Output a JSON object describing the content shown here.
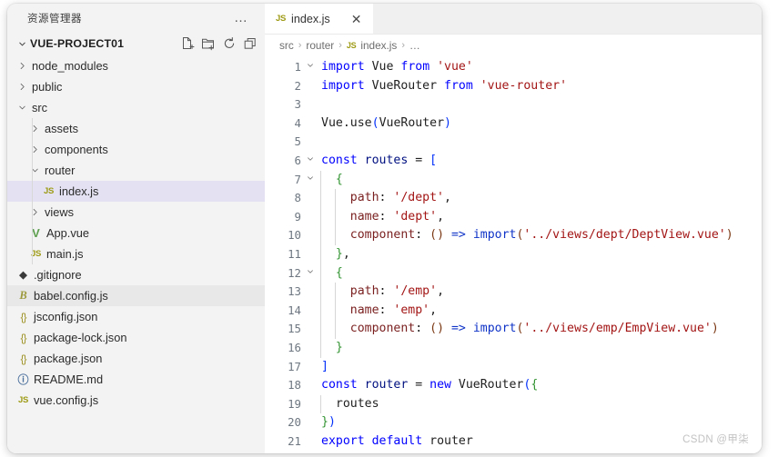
{
  "window": {
    "accent_selection": "#e4e2f2",
    "sidebar_bg": "#f3f3f3"
  },
  "sidebar": {
    "header_title": "资源管理器",
    "more_actions": "…",
    "project": {
      "name": "VUE-PROJECT01",
      "expanded": true,
      "actions": [
        {
          "name": "new-file",
          "tooltip": "New File"
        },
        {
          "name": "new-folder",
          "tooltip": "New Folder"
        },
        {
          "name": "refresh",
          "tooltip": "Refresh Explorer"
        },
        {
          "name": "collapse-all",
          "tooltip": "Collapse Folders in Explorer"
        }
      ]
    },
    "tree": [
      {
        "label": "node_modules",
        "type": "folder",
        "expanded": false,
        "depth": 1,
        "icon": "chevron-right-icon",
        "state": ""
      },
      {
        "label": "public",
        "type": "folder",
        "expanded": false,
        "depth": 1,
        "icon": "chevron-right-icon",
        "state": ""
      },
      {
        "label": "src",
        "type": "folder",
        "expanded": true,
        "depth": 1,
        "icon": "chevron-down-icon",
        "state": ""
      },
      {
        "label": "assets",
        "type": "folder",
        "expanded": false,
        "depth": 2,
        "icon": "chevron-right-icon",
        "state": ""
      },
      {
        "label": "components",
        "type": "folder",
        "expanded": false,
        "depth": 2,
        "icon": "chevron-right-icon",
        "state": ""
      },
      {
        "label": "router",
        "type": "folder",
        "expanded": true,
        "depth": 2,
        "icon": "chevron-down-icon",
        "state": ""
      },
      {
        "label": "index.js",
        "type": "file",
        "depth": 3,
        "icon": "js-file-icon",
        "state": "selected"
      },
      {
        "label": "views",
        "type": "folder",
        "expanded": false,
        "depth": 2,
        "icon": "chevron-right-icon",
        "state": ""
      },
      {
        "label": "App.vue",
        "type": "file",
        "depth": 2,
        "icon": "vue-file-icon",
        "state": ""
      },
      {
        "label": "main.js",
        "type": "file",
        "depth": 2,
        "icon": "js-file-icon",
        "state": ""
      },
      {
        "label": ".gitignore",
        "type": "file",
        "depth": 1,
        "icon": "git-file-icon",
        "state": ""
      },
      {
        "label": "babel.config.js",
        "type": "file",
        "depth": 1,
        "icon": "babel-file-icon",
        "state": "hover"
      },
      {
        "label": "jsconfig.json",
        "type": "file",
        "depth": 1,
        "icon": "json-file-icon",
        "state": ""
      },
      {
        "label": "package-lock.json",
        "type": "file",
        "depth": 1,
        "icon": "json-file-icon",
        "state": ""
      },
      {
        "label": "package.json",
        "type": "file",
        "depth": 1,
        "icon": "json-file-icon",
        "state": ""
      },
      {
        "label": "README.md",
        "type": "file",
        "depth": 1,
        "icon": "markdown-file-icon",
        "state": ""
      },
      {
        "label": "vue.config.js",
        "type": "file",
        "depth": 1,
        "icon": "js-file-icon",
        "state": ""
      }
    ]
  },
  "editor": {
    "tabs": [
      {
        "label": "index.js",
        "icon": "js-file-icon",
        "active": true,
        "close_label": "✕"
      }
    ],
    "breadcrumb": [
      {
        "label": "src",
        "icon": ""
      },
      {
        "label": "router",
        "icon": ""
      },
      {
        "label": "index.js",
        "icon": "js-file-icon"
      },
      {
        "label": "…",
        "icon": ""
      }
    ],
    "breadcrumb_separator": "›",
    "lines": [
      {
        "n": "1",
        "fold": "down",
        "guides": 0,
        "tokens": [
          {
            "t": "import",
            "c": "kw"
          },
          {
            "t": " ",
            "c": "op"
          },
          {
            "t": "Vue",
            "c": "id"
          },
          {
            "t": " ",
            "c": "op"
          },
          {
            "t": "from",
            "c": "kw"
          },
          {
            "t": " ",
            "c": "op"
          },
          {
            "t": "'vue'",
            "c": "str"
          }
        ]
      },
      {
        "n": "2",
        "fold": "",
        "guides": 0,
        "tokens": [
          {
            "t": "import",
            "c": "kw"
          },
          {
            "t": " ",
            "c": "op"
          },
          {
            "t": "VueRouter",
            "c": "id"
          },
          {
            "t": " ",
            "c": "op"
          },
          {
            "t": "from",
            "c": "kw"
          },
          {
            "t": " ",
            "c": "op"
          },
          {
            "t": "'vue-router'",
            "c": "str"
          }
        ]
      },
      {
        "n": "3",
        "fold": "",
        "guides": 0,
        "tokens": []
      },
      {
        "n": "4",
        "fold": "",
        "guides": 0,
        "tokens": [
          {
            "t": "Vue",
            "c": "id"
          },
          {
            "t": ".",
            "c": "op"
          },
          {
            "t": "use",
            "c": "fn"
          },
          {
            "t": "(",
            "c": "br0"
          },
          {
            "t": "VueRouter",
            "c": "id"
          },
          {
            "t": ")",
            "c": "br0"
          }
        ]
      },
      {
        "n": "5",
        "fold": "",
        "guides": 0,
        "tokens": []
      },
      {
        "n": "6",
        "fold": "down",
        "guides": 0,
        "tokens": [
          {
            "t": "const",
            "c": "kw"
          },
          {
            "t": " ",
            "c": "op"
          },
          {
            "t": "routes",
            "c": "pl"
          },
          {
            "t": " = ",
            "c": "op"
          },
          {
            "t": "[",
            "c": "br0"
          }
        ]
      },
      {
        "n": "7",
        "fold": "down",
        "guides": 1,
        "tokens": [
          {
            "t": "  ",
            "c": "op"
          },
          {
            "t": "{",
            "c": "br1"
          }
        ]
      },
      {
        "n": "8",
        "fold": "",
        "guides": 2,
        "tokens": [
          {
            "t": "    ",
            "c": "op"
          },
          {
            "t": "path",
            "c": "prop"
          },
          {
            "t": ": ",
            "c": "op"
          },
          {
            "t": "'/dept'",
            "c": "str"
          },
          {
            "t": ",",
            "c": "op"
          }
        ]
      },
      {
        "n": "9",
        "fold": "",
        "guides": 2,
        "tokens": [
          {
            "t": "    ",
            "c": "op"
          },
          {
            "t": "name",
            "c": "prop"
          },
          {
            "t": ": ",
            "c": "op"
          },
          {
            "t": "'dept'",
            "c": "str"
          },
          {
            "t": ",",
            "c": "op"
          }
        ]
      },
      {
        "n": "10",
        "fold": "",
        "guides": 2,
        "tokens": [
          {
            "t": "    ",
            "c": "op"
          },
          {
            "t": "component",
            "c": "prop"
          },
          {
            "t": ": ",
            "c": "op"
          },
          {
            "t": "(",
            "c": "br2"
          },
          {
            "t": ")",
            "c": "br2"
          },
          {
            "t": " ",
            "c": "op"
          },
          {
            "t": "=>",
            "c": "kw2"
          },
          {
            "t": " ",
            "c": "op"
          },
          {
            "t": "import",
            "c": "kw2"
          },
          {
            "t": "(",
            "c": "br2"
          },
          {
            "t": "'../views/dept/DeptView.vue'",
            "c": "str"
          },
          {
            "t": ")",
            "c": "br2"
          }
        ]
      },
      {
        "n": "11",
        "fold": "",
        "guides": 1,
        "tokens": [
          {
            "t": "  ",
            "c": "op"
          },
          {
            "t": "}",
            "c": "br1"
          },
          {
            "t": ",",
            "c": "op"
          }
        ]
      },
      {
        "n": "12",
        "fold": "down",
        "guides": 1,
        "tokens": [
          {
            "t": "  ",
            "c": "op"
          },
          {
            "t": "{",
            "c": "br1"
          }
        ]
      },
      {
        "n": "13",
        "fold": "",
        "guides": 2,
        "tokens": [
          {
            "t": "    ",
            "c": "op"
          },
          {
            "t": "path",
            "c": "prop"
          },
          {
            "t": ": ",
            "c": "op"
          },
          {
            "t": "'/emp'",
            "c": "str"
          },
          {
            "t": ",",
            "c": "op"
          }
        ]
      },
      {
        "n": "14",
        "fold": "",
        "guides": 2,
        "tokens": [
          {
            "t": "    ",
            "c": "op"
          },
          {
            "t": "name",
            "c": "prop"
          },
          {
            "t": ": ",
            "c": "op"
          },
          {
            "t": "'emp'",
            "c": "str"
          },
          {
            "t": ",",
            "c": "op"
          }
        ]
      },
      {
        "n": "15",
        "fold": "",
        "guides": 2,
        "tokens": [
          {
            "t": "    ",
            "c": "op"
          },
          {
            "t": "component",
            "c": "prop"
          },
          {
            "t": ": ",
            "c": "op"
          },
          {
            "t": "(",
            "c": "br2"
          },
          {
            "t": ")",
            "c": "br2"
          },
          {
            "t": " ",
            "c": "op"
          },
          {
            "t": "=>",
            "c": "kw2"
          },
          {
            "t": " ",
            "c": "op"
          },
          {
            "t": "import",
            "c": "kw2"
          },
          {
            "t": "(",
            "c": "br2"
          },
          {
            "t": "'../views/emp/EmpView.vue'",
            "c": "str"
          },
          {
            "t": ")",
            "c": "br2"
          }
        ]
      },
      {
        "n": "16",
        "fold": "",
        "guides": 1,
        "tokens": [
          {
            "t": "  ",
            "c": "op"
          },
          {
            "t": "}",
            "c": "br1"
          }
        ]
      },
      {
        "n": "17",
        "fold": "",
        "guides": 0,
        "tokens": [
          {
            "t": "]",
            "c": "br0"
          }
        ]
      },
      {
        "n": "18",
        "fold": "",
        "guides": 0,
        "tokens": [
          {
            "t": "const",
            "c": "kw"
          },
          {
            "t": " ",
            "c": "op"
          },
          {
            "t": "router",
            "c": "pl"
          },
          {
            "t": " = ",
            "c": "op"
          },
          {
            "t": "new",
            "c": "kw"
          },
          {
            "t": " ",
            "c": "op"
          },
          {
            "t": "VueRouter",
            "c": "id"
          },
          {
            "t": "(",
            "c": "br0"
          },
          {
            "t": "{",
            "c": "br1"
          }
        ]
      },
      {
        "n": "19",
        "fold": "",
        "guides": 1,
        "tokens": [
          {
            "t": "  ",
            "c": "op"
          },
          {
            "t": "routes",
            "c": "id"
          }
        ]
      },
      {
        "n": "20",
        "fold": "",
        "guides": 0,
        "tokens": [
          {
            "t": "}",
            "c": "br1"
          },
          {
            "t": ")",
            "c": "br0"
          }
        ]
      },
      {
        "n": "21",
        "fold": "",
        "guides": 0,
        "tokens": [
          {
            "t": "export",
            "c": "kw"
          },
          {
            "t": " ",
            "c": "op"
          },
          {
            "t": "default",
            "c": "kw"
          },
          {
            "t": " ",
            "c": "op"
          },
          {
            "t": "router",
            "c": "id"
          }
        ]
      }
    ]
  },
  "watermark": "CSDN @甲柒"
}
